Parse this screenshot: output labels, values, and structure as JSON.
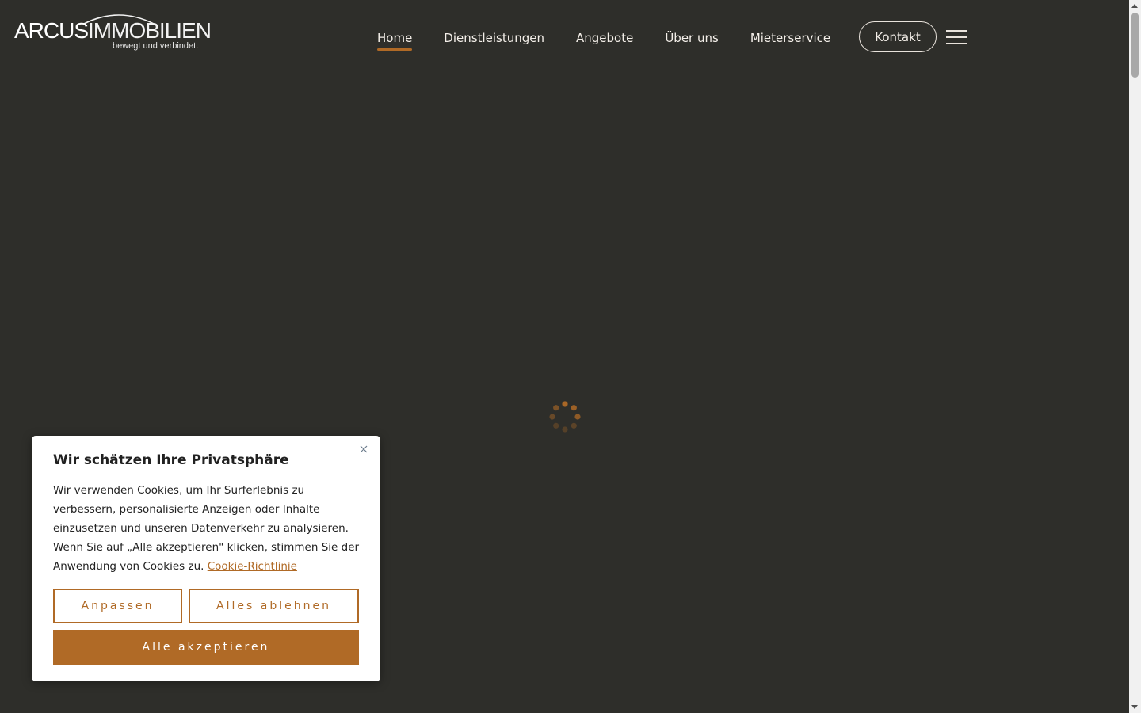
{
  "header": {
    "logo": {
      "word_bold": "ARCUS",
      "word_thin": "IMMOBILIEN",
      "tagline": "bewegt und verbindet."
    },
    "nav": [
      {
        "label": "Home",
        "active": true
      },
      {
        "label": "Dienstleistungen",
        "active": false
      },
      {
        "label": "Angebote",
        "active": false
      },
      {
        "label": "Über uns",
        "active": false
      },
      {
        "label": "Mieterservice",
        "active": false
      }
    ],
    "contact_label": "Kontakt",
    "menu_icon": "hamburger-icon"
  },
  "colors": {
    "background": "#2e2e2a",
    "accent": "#b06a26",
    "nav_text": "#f4efe9"
  },
  "loader": {
    "icon": "spinner-icon"
  },
  "cookie_banner": {
    "title": "Wir schätzen Ihre Privatsphäre",
    "text": "Wir verwenden Cookies, um Ihr Surferlebnis zu verbessern, personalisierte Anzeigen oder Inhalte einzusetzen und unseren Datenverkehr zu analysieren. Wenn Sie auf „Alle akzeptieren\" klicken, stimmen Sie der Anwendung von Cookies zu.",
    "link_label": "Cookie-Richtlinie",
    "customize_label": "Anpassen",
    "reject_label": "Alles ablehnen",
    "accept_label": "Alle akzeptieren",
    "close_icon": "close-icon"
  }
}
